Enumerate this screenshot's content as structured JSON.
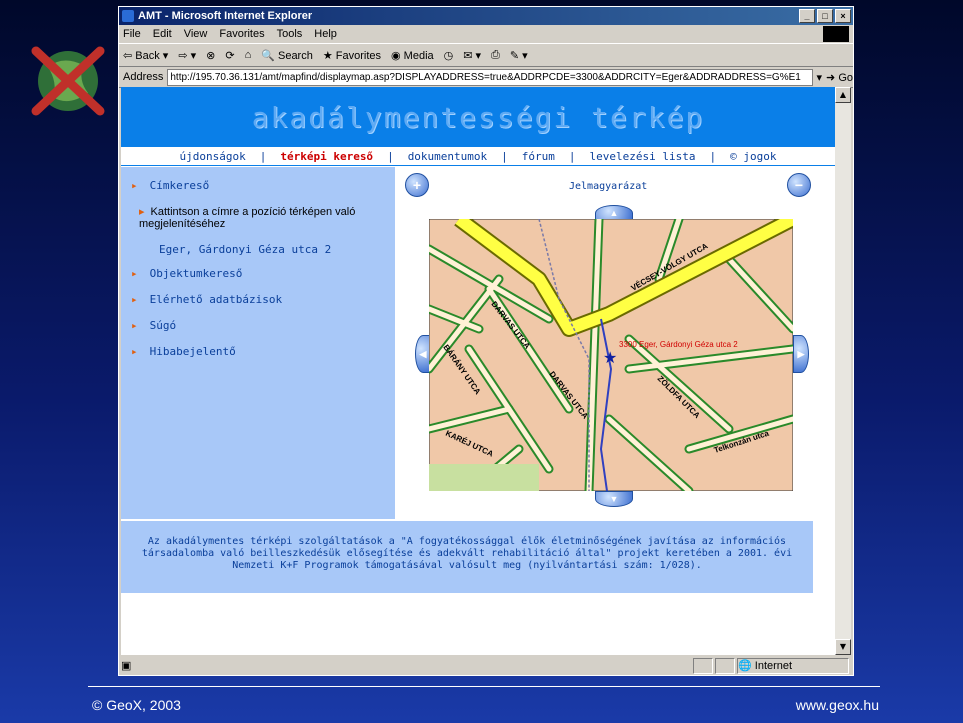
{
  "window": {
    "title": "AMT - Microsoft Internet Explorer",
    "menu": [
      "File",
      "Edit",
      "View",
      "Favorites",
      "Tools",
      "Help"
    ],
    "toolbar": {
      "back": "Back",
      "search": "Search",
      "favorites": "Favorites",
      "media": "Media"
    },
    "address_label": "Address",
    "address_url": "http://195.70.36.131/amt/mapfind/displaymap.asp?DISPLAYADDRESS=true&ADDRPCDE=3300&ADDRCITY=Eger&ADDRADDRESS=G%E1",
    "go_label": "Go",
    "status_zone": "Internet"
  },
  "page": {
    "banner": "akadálymentességi térkép",
    "nav": [
      {
        "label": "újdonságok"
      },
      {
        "label": "térképi kereső"
      },
      {
        "label": "dokumentumok"
      },
      {
        "label": "fórum"
      },
      {
        "label": "levelezési lista"
      },
      {
        "label": "© jogok"
      }
    ],
    "separator": "|",
    "sidebar": {
      "item1": "Címkereső",
      "hint": "Kattintson a címre a pozíció térképen való megjelenítéséhez",
      "result": "Eger, Gárdonyi Géza utca 2",
      "item2": "Objektumkereső",
      "item3": "Elérhető adatbázisok",
      "item4": "Súgó",
      "item5": "Hibabejelentő"
    },
    "map": {
      "legend_link": "Jelmagyarázat",
      "zoom_in": "+",
      "zoom_out": "−",
      "marker_label": "3300 Eger, Gárdonyi Géza utca 2",
      "streets": [
        "VÉCSEY-VÖLGY UTCA",
        "DARVAS UTCA",
        "DARVAS UTCA",
        "BÁRÁNY UTCA",
        "KARÉJ UTCA",
        "ZÖLDFA UTCA",
        "Telkonzán utca"
      ]
    },
    "footer": "Az akadálymentes térképi szolgáltatások a \"A fogyatékossággal élők életminőségének javítása az információs társadalomba való beilleszkedésük elősegítése és adekvált rehabilitáció által\" projekt keretében a 2001. évi Nemzeti K+F Programok támogatásával valósult meg (nyilvántartási szám: 1/028)."
  },
  "slide": {
    "copyright": "© GeoX, 2003",
    "website": "www.geox.hu"
  }
}
